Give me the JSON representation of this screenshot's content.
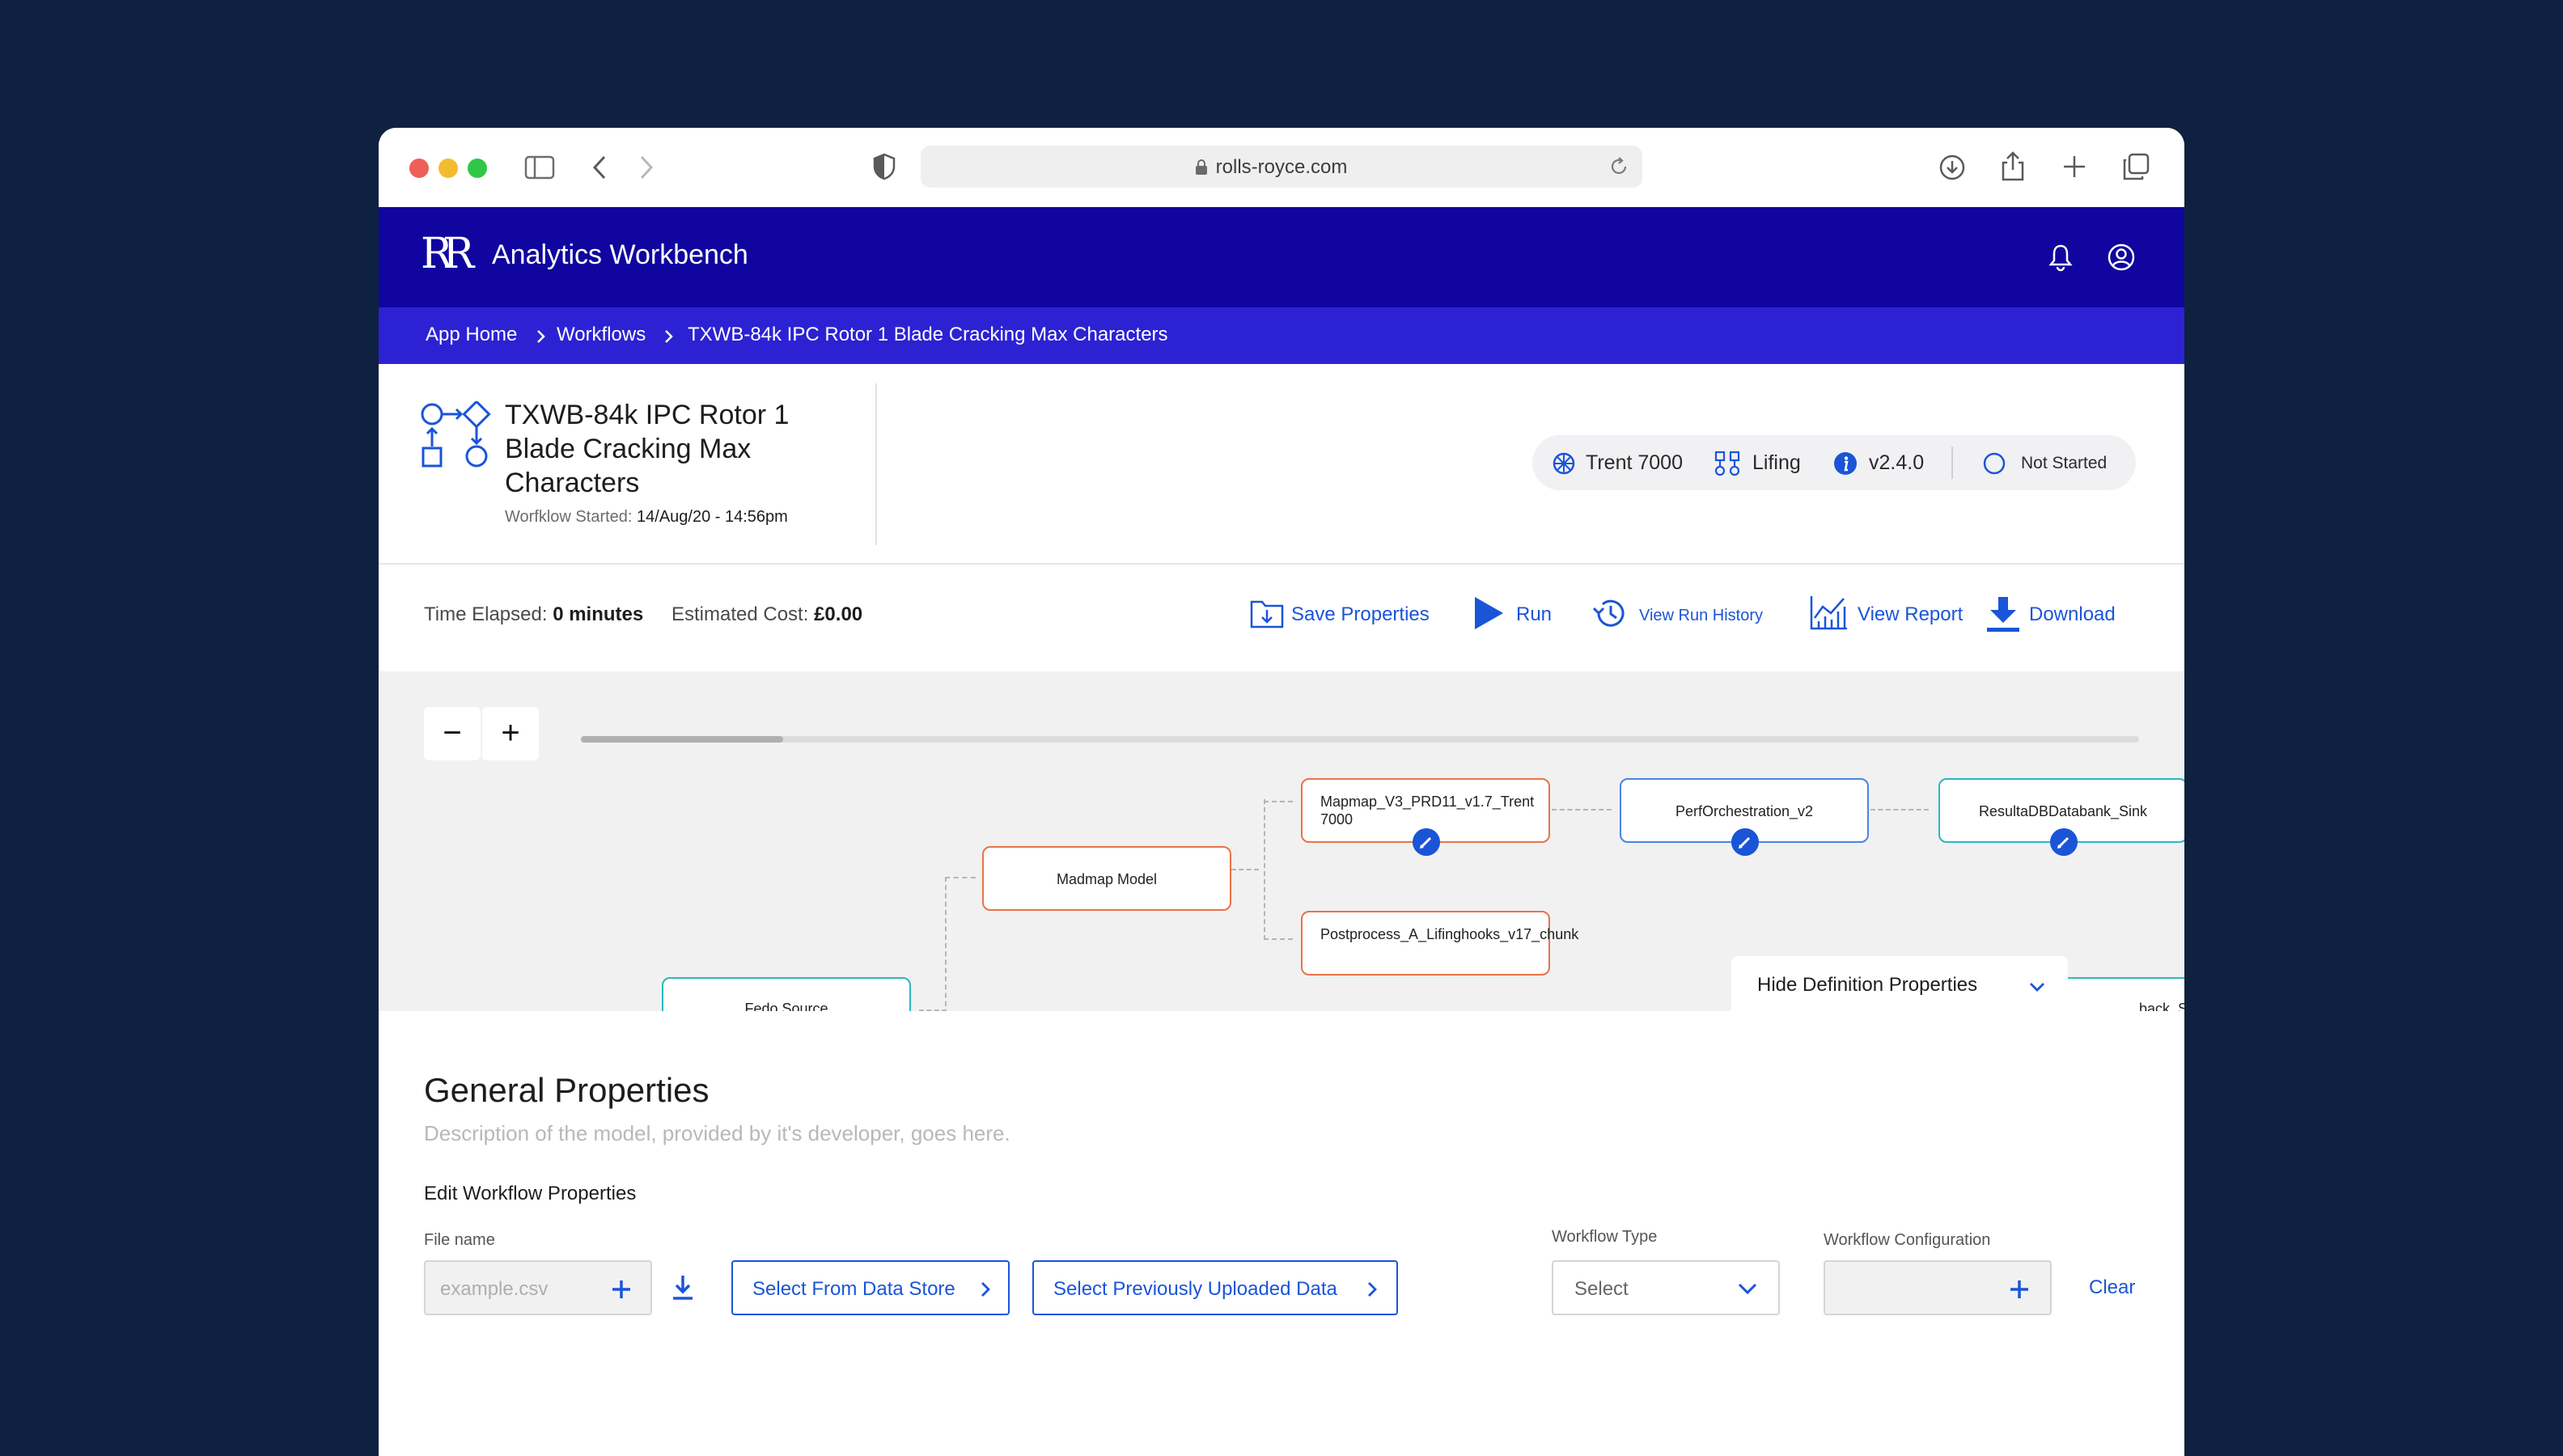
{
  "browser": {
    "url": "rolls-royce.com"
  },
  "header": {
    "app_title": "Analytics Workbench",
    "logo": "RR"
  },
  "breadcrumb": {
    "items": [
      "App Home",
      "Workflows",
      "TXWB-84k IPC Rotor 1 Blade Cracking Max Characters"
    ]
  },
  "workflow": {
    "title_lines": [
      "TXWB-84k IPC Rotor 1",
      "Blade Cracking Max",
      "Characters"
    ],
    "started_label": "Worfklow Started:",
    "started_value": "14/Aug/20 - 14:56pm",
    "tags": {
      "engine": "Trent 7000",
      "category": "Lifing",
      "version": "v2.4.0",
      "status": "Not Started"
    }
  },
  "meta": {
    "time_label": "Time Elapsed:",
    "time_value": "0 minutes",
    "cost_label": "Estimated Cost:",
    "cost_value": "£0.00"
  },
  "actions": {
    "save": "Save Properties",
    "run": "Run",
    "history": "View Run History",
    "report": "View Report",
    "download": "Download"
  },
  "canvas": {
    "zoom_out": "−",
    "zoom_in": "+",
    "scroll_position": 0.13,
    "nodes": {
      "madmap": "Madmap Model",
      "mapmap": "Mapmap_V3_PRD11_v1.7_Trent 7000",
      "postprocess": "Postprocess_A_Lifinghooks_v17_chunk",
      "perf": "PerfOrchestration_v2",
      "results": "ResultaDBDatabank_Sink",
      "source": "Fedo Source",
      "sink": "...back_Sink"
    },
    "hide_definition": "Hide Definition Properties"
  },
  "general": {
    "title": "General Properties",
    "description": "Description of the model, provided by it's developer, goes here.",
    "edit_label": "Edit Workflow Properties",
    "file_label": "File name",
    "file_placeholder": "example.csv",
    "select_store": "Select From Data Store",
    "select_uploaded": "Select Previously Uploaded Data",
    "type_label": "Workflow Type",
    "type_value": "Select",
    "config_label": "Workflow Configuration",
    "clear": "Clear"
  },
  "colors": {
    "background": "#0f2140",
    "brand": "#10069f",
    "breadcrumb_bar": "#2c22d4",
    "accent": "#1a55d8",
    "node_orange": "#e8734a",
    "node_blue": "#4a85e0",
    "node_teal": "#2cb6bf"
  }
}
